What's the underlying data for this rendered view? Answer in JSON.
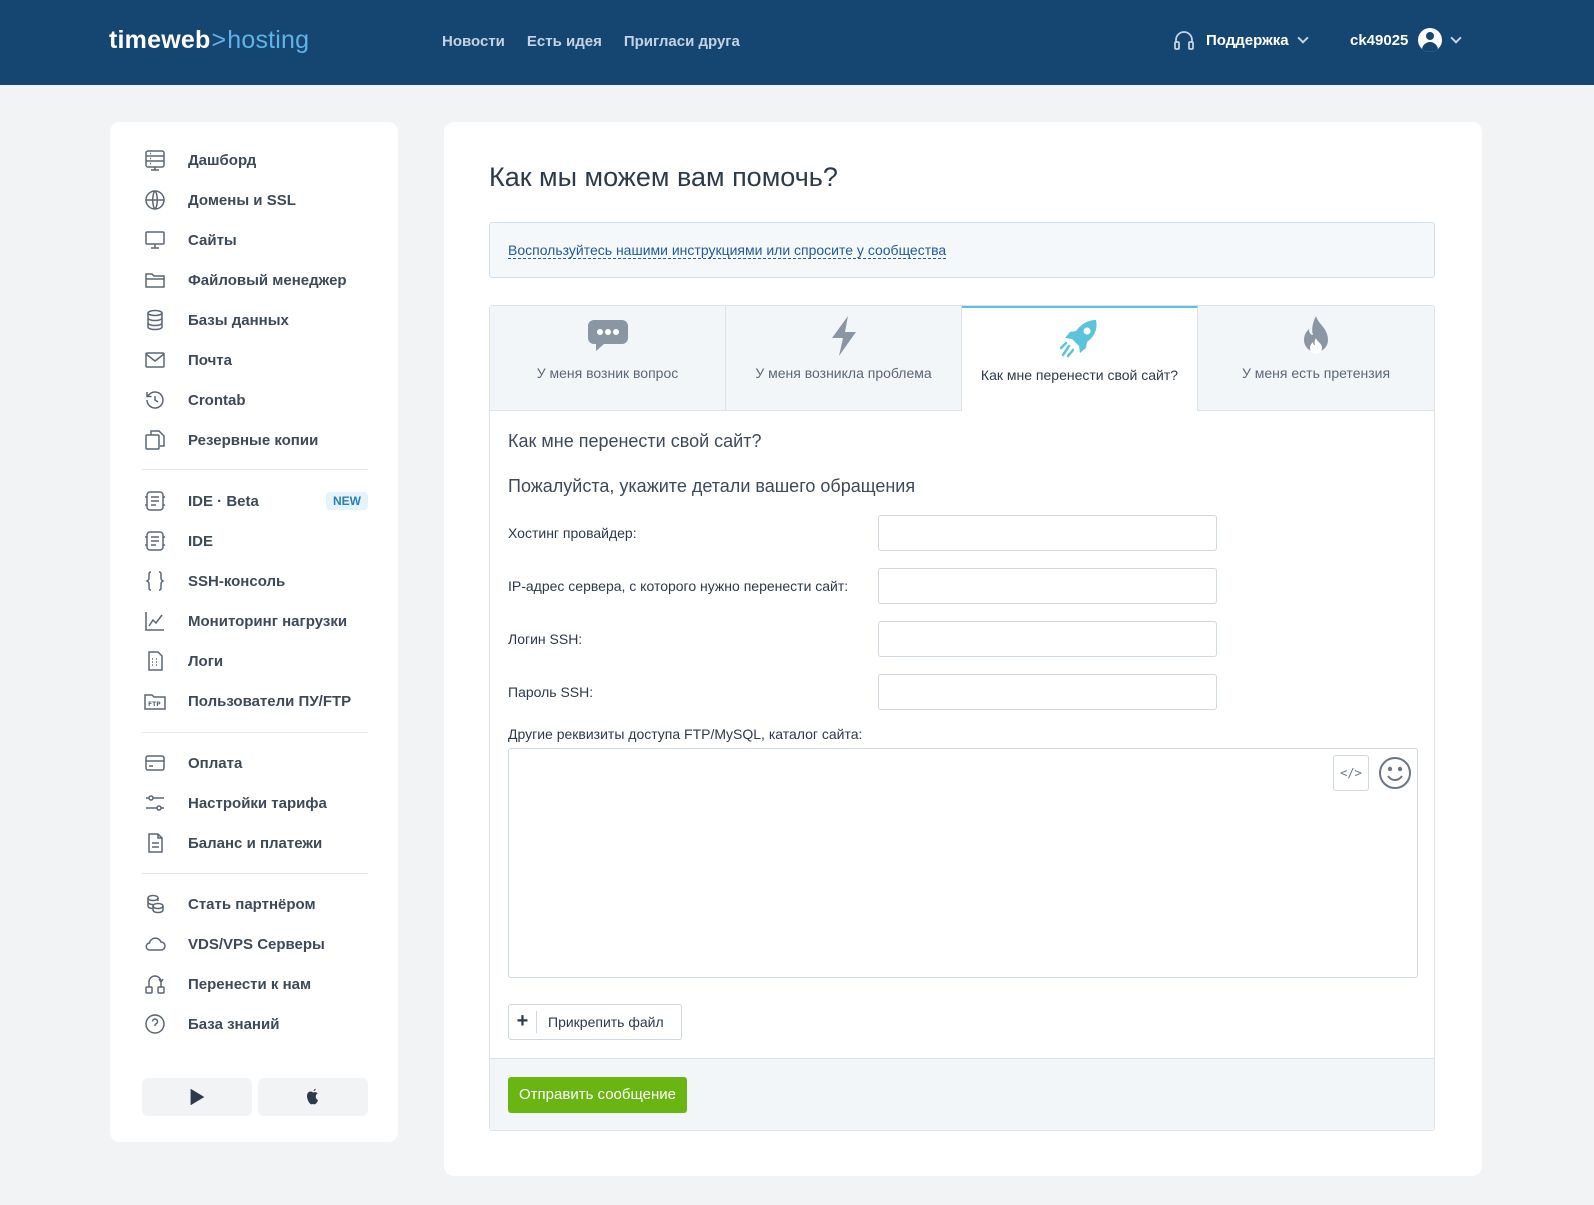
{
  "header": {
    "logo_main": "timeweb",
    "logo_sep": ">",
    "logo_sub": "hosting",
    "nav": [
      "Новости",
      "Есть идея",
      "Пригласи друга"
    ],
    "support_label": "Поддержка",
    "username": "ck49025"
  },
  "sidebar": {
    "group1": [
      "Дашборд",
      "Домены и SSL",
      "Сайты",
      "Файловый менеджер",
      "Базы данных",
      "Почта",
      "Crontab",
      "Резервные копии"
    ],
    "group2": [
      "IDE · Beta",
      "IDE",
      "SSH-консоль",
      "Мониторинг нагрузки",
      "Логи",
      "Пользователи ПУ/FTP"
    ],
    "new_badge": "NEW",
    "group3": [
      "Оплата",
      "Настройки тарифа",
      "Баланс и платежи"
    ],
    "group4": [
      "Стать партнёром",
      "VDS/VPS Серверы",
      "Перенести к нам",
      "База знаний"
    ]
  },
  "main": {
    "title": "Как мы можем вам помочь?",
    "hint_link": "Воспользуйтесь нашими инструкциями или спросите у сообщества",
    "tabs": [
      {
        "label": "У меня возник вопрос",
        "icon": "chat-bubble-icon"
      },
      {
        "label": "У меня возникла проблема",
        "icon": "lightning-icon"
      },
      {
        "label": "Как мне перенести свой сайт?",
        "icon": "rocket-icon"
      },
      {
        "label": "У меня есть претензия",
        "icon": "flame-icon"
      }
    ],
    "form_title": "Как мне перенести свой сайт?",
    "form_subtitle": "Пожалуйста, укажите детали вашего обращения",
    "fields": [
      {
        "label": "Хостинг провайдер:",
        "value": ""
      },
      {
        "label": "IP-адрес сервера, с которого нужно перенести сайт:",
        "value": ""
      },
      {
        "label": "Логин SSH:",
        "value": ""
      },
      {
        "label": "Пароль SSH:",
        "value": ""
      }
    ],
    "textarea_label": "Другие реквизиты доступа FTP/MySQL, каталог сайта:",
    "textarea_value": "",
    "code_btn": "</>",
    "attach_plus": "+",
    "attach_label": "Прикрепить файл",
    "submit_label": "Отправить сообщение"
  },
  "colors": {
    "header_bg": "#154571",
    "accent_blue": "#5fb3e6",
    "submit_green": "#69b612",
    "active_tab_border": "#5cc3dd"
  }
}
